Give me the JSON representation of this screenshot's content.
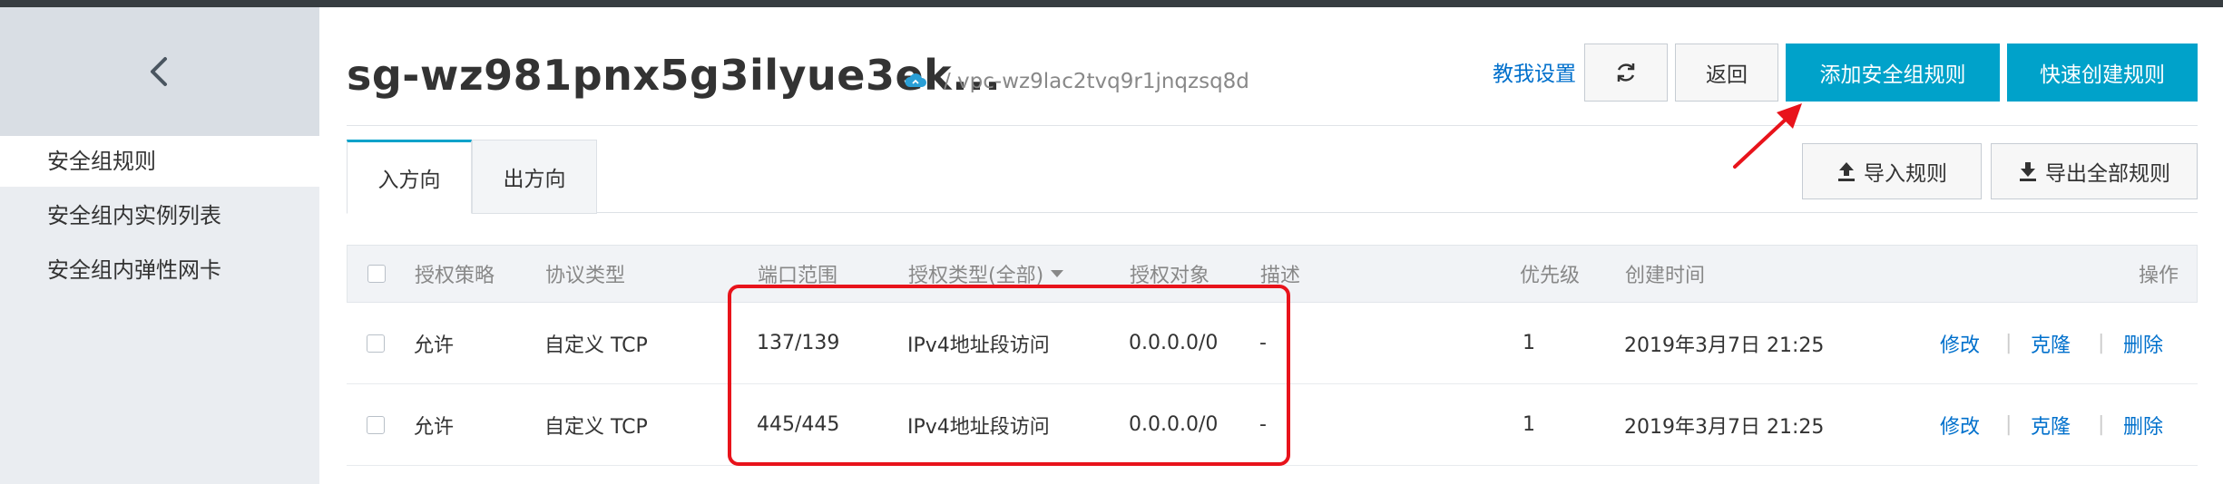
{
  "sidebar": {
    "items": [
      {
        "label": "安全组规则",
        "active": true
      },
      {
        "label": "安全组内实例列表",
        "active": false
      },
      {
        "label": "安全组内弹性网卡",
        "active": false
      }
    ]
  },
  "header": {
    "title": "sg-wz981pnx5g3ilyue3ek...",
    "vpc": "/ vpc-wz9lac2tvq9r1jnqzsq8d",
    "help_link": "教我设置",
    "back_button": "返回",
    "add_rule_button": "添加安全组规则",
    "quick_create_button": "快速创建规则"
  },
  "tabs": [
    {
      "label": "入方向",
      "active": true
    },
    {
      "label": "出方向",
      "active": false
    }
  ],
  "toolbar": {
    "import_button": "导入规则",
    "export_button": "导出全部规则"
  },
  "table": {
    "columns": [
      "授权策略",
      "协议类型",
      "端口范围",
      "授权类型(全部)",
      "授权对象",
      "描述",
      "优先级",
      "创建时间",
      "操作"
    ],
    "rows": [
      {
        "policy": "允许",
        "protocol": "自定义 TCP",
        "port": "137/139",
        "auth_type": "IPv4地址段访问",
        "auth_object": "0.0.0.0/0",
        "desc": "-",
        "priority": "1",
        "created": "2019年3月7日 21:25",
        "actions": [
          "修改",
          "克隆",
          "删除"
        ]
      },
      {
        "policy": "允许",
        "protocol": "自定义 TCP",
        "port": "445/445",
        "auth_type": "IPv4地址段访问",
        "auth_object": "0.0.0.0/0",
        "desc": "-",
        "priority": "1",
        "created": "2019年3月7日 21:25",
        "actions": [
          "修改",
          "克隆",
          "删除"
        ]
      }
    ]
  },
  "colors": {
    "primary": "#00a2ca",
    "link": "#0070cc",
    "annotation": "#e8131b",
    "sidebar_bg": "#eaedf1"
  }
}
